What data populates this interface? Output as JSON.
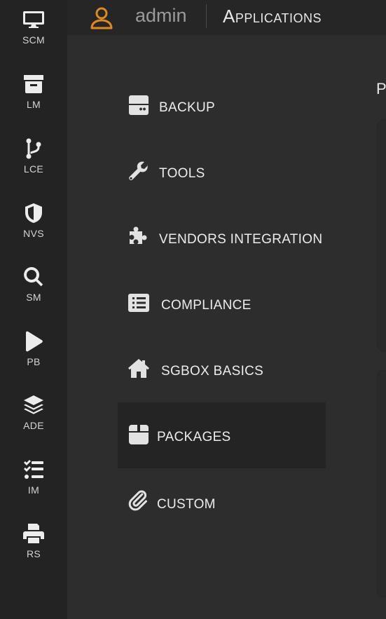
{
  "header": {
    "user_name": "admin",
    "section_title": "Applications"
  },
  "rail": {
    "items": [
      {
        "label": "SCM",
        "icon": "monitor-icon"
      },
      {
        "label": "LM",
        "icon": "archive-box-icon"
      },
      {
        "label": "LCE",
        "icon": "code-branch-icon"
      },
      {
        "label": "NVS",
        "icon": "shield-icon"
      },
      {
        "label": "SM",
        "icon": "search-icon"
      },
      {
        "label": "PB",
        "icon": "play-icon"
      },
      {
        "label": "ADE",
        "icon": "layers-icon"
      },
      {
        "label": "IM",
        "icon": "task-list-icon"
      },
      {
        "label": "RS",
        "icon": "printer-icon"
      }
    ]
  },
  "menu": {
    "items": [
      {
        "label": "BACKUP",
        "icon": "hard-drive-icon",
        "active": false
      },
      {
        "label": "TOOLS",
        "icon": "wrench-icon",
        "active": false
      },
      {
        "label": "VENDORS INTEGRATION",
        "icon": "puzzle-piece-icon",
        "active": false
      },
      {
        "label": "COMPLIANCE",
        "icon": "list-alt-icon",
        "active": false
      },
      {
        "label": "SGBOX BASICS",
        "icon": "home-icon",
        "active": false
      },
      {
        "label": "PACKAGES",
        "icon": "box-icon",
        "active": true
      },
      {
        "label": "CUSTOM",
        "icon": "paperclip-icon",
        "active": false
      }
    ]
  },
  "content": {
    "title_partial": "P"
  },
  "colors": {
    "rail_bg": "#232323",
    "page_bg": "#2d2d2d",
    "topbar_bg": "#262626",
    "accent_user_icon": "#e08a1e",
    "active_item_bg": "#242424"
  }
}
